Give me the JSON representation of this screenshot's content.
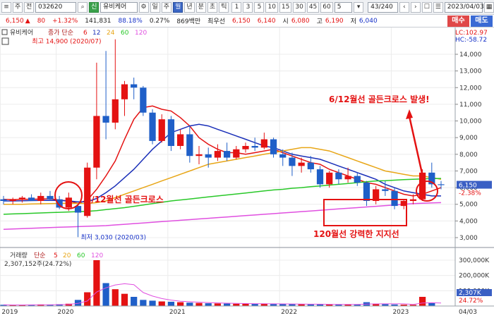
{
  "toolbar": {
    "market_label": "주",
    "sub_label": "전",
    "code": "032620",
    "search_icon": "magnifier-icon",
    "badge": "신",
    "name": "유비케어",
    "periods": [
      "일",
      "주",
      "월",
      "년",
      "분",
      "초",
      "틱"
    ],
    "active_period": "월",
    "minutes": [
      "1",
      "3",
      "5",
      "10",
      "15",
      "30",
      "45",
      "60"
    ],
    "interval": "5",
    "count": "43/240",
    "date": "2023/04/03"
  },
  "quote": {
    "price": "6,150",
    "arrow": "▲",
    "change": "80",
    "change_pct": "+1.32%",
    "volume": "141,831",
    "ratio": "88.18%",
    "turnover": "0.27%",
    "amount": "869백만",
    "prefer": "최우선",
    "bid": "6,150",
    "ask": "6,140",
    "open_label": "시",
    "open": "6,080",
    "high_label": "고",
    "high": "6,190",
    "low_label": "저",
    "low": "6,040",
    "buy_label": "매수",
    "sell_label": "매도"
  },
  "price_panel": {
    "name": "유비케어",
    "ma_legend_prefix": "종가 단순",
    "ma_periods": [
      "6",
      "12",
      "24",
      "60",
      "120"
    ],
    "lc": "LC:102.97",
    "hc": "HC:-58.72",
    "last_price": "6,150",
    "last_pct": "-2.38%",
    "high_note": "최고 14,900 (2020/07)",
    "low_note": "최저 3,030 (2020/03)",
    "y_ticks": [
      "14,000",
      "13,000",
      "12,000",
      "11,000",
      "10,000",
      "9,000",
      "8,000",
      "7,000",
      "6,000",
      "5,000",
      "4,000",
      "3,000"
    ]
  },
  "annotations": {
    "golden_cross_left": "6/12월선 골든크로스",
    "golden_cross_right": "6/12월선 골든크로스 발생!",
    "support": "120월선 강력한 지지선"
  },
  "volume_panel": {
    "label": "거래량",
    "ma_prefix": "단순",
    "ma_periods": [
      "5",
      "20",
      "60",
      "120"
    ],
    "volume_text": "2,307,152주(24.72%)",
    "y_ticks": [
      "300,000K",
      "200,000K",
      "100,000K"
    ],
    "last_vol": "2,307K",
    "last_pct": "24.72%"
  },
  "x_axis": {
    "labels": [
      "2019",
      "2020",
      "2021",
      "2022",
      "2023"
    ],
    "end_label": "04/03"
  },
  "colors": {
    "up": "#e41212",
    "down": "#1f5fc8",
    "ma6": "#e41212",
    "ma12": "#1a2fb8",
    "ma24": "#e8a617",
    "ma60": "#28c828",
    "ma120": "#e050e0",
    "annotation": "#e41212"
  },
  "chart_data": {
    "type": "candlestick",
    "x_range": [
      "2019/07",
      "2023/04"
    ],
    "ylim": [
      2500,
      14900
    ],
    "candles": [
      {
        "t": "2019/07",
        "o": 5300,
        "h": 5500,
        "l": 5000,
        "c": 5200
      },
      {
        "t": "2019/08",
        "o": 5200,
        "h": 5400,
        "l": 5000,
        "c": 5300
      },
      {
        "t": "2019/09",
        "o": 5300,
        "h": 5500,
        "l": 5100,
        "c": 5400
      },
      {
        "t": "2019/10",
        "o": 5400,
        "h": 5600,
        "l": 5200,
        "c": 5200
      },
      {
        "t": "2019/11",
        "o": 5200,
        "h": 5700,
        "l": 5000,
        "c": 5500
      },
      {
        "t": "2019/12",
        "o": 5500,
        "h": 5800,
        "l": 5200,
        "c": 5300
      },
      {
        "t": "2020/01",
        "o": 5300,
        "h": 5500,
        "l": 4700,
        "c": 4800
      },
      {
        "t": "2020/02",
        "o": 4800,
        "h": 5700,
        "l": 4600,
        "c": 5400
      },
      {
        "t": "2020/03",
        "o": 4900,
        "h": 5000,
        "l": 3030,
        "c": 4500
      },
      {
        "t": "2020/04",
        "o": 4300,
        "h": 7500,
        "l": 4200,
        "c": 7200
      },
      {
        "t": "2020/05",
        "o": 7200,
        "h": 13500,
        "l": 6500,
        "c": 10300
      },
      {
        "t": "2020/06",
        "o": 10300,
        "h": 14200,
        "l": 8900,
        "c": 9900
      },
      {
        "t": "2020/07",
        "o": 9900,
        "h": 14900,
        "l": 9500,
        "c": 11300
      },
      {
        "t": "2020/08",
        "o": 11300,
        "h": 12400,
        "l": 10300,
        "c": 12200
      },
      {
        "t": "2020/09",
        "o": 12200,
        "h": 12600,
        "l": 11300,
        "c": 12000
      },
      {
        "t": "2020/10",
        "o": 12000,
        "h": 12100,
        "l": 10300,
        "c": 10500
      },
      {
        "t": "2020/11",
        "o": 10500,
        "h": 10700,
        "l": 8600,
        "c": 8800
      },
      {
        "t": "2020/12",
        "o": 8800,
        "h": 10400,
        "l": 8700,
        "c": 10100
      },
      {
        "t": "2021/01",
        "o": 10100,
        "h": 10300,
        "l": 8200,
        "c": 8500
      },
      {
        "t": "2021/02",
        "o": 8500,
        "h": 9500,
        "l": 8300,
        "c": 9200
      },
      {
        "t": "2021/03",
        "o": 9200,
        "h": 9700,
        "l": 7500,
        "c": 7900
      },
      {
        "t": "2021/04",
        "o": 7900,
        "h": 8500,
        "l": 7400,
        "c": 8000
      },
      {
        "t": "2021/05",
        "o": 8000,
        "h": 8400,
        "l": 7200,
        "c": 7800
      },
      {
        "t": "2021/06",
        "o": 7800,
        "h": 8600,
        "l": 7600,
        "c": 8200
      },
      {
        "t": "2021/07",
        "o": 8200,
        "h": 8700,
        "l": 7600,
        "c": 7800
      },
      {
        "t": "2021/08",
        "o": 7800,
        "h": 8500,
        "l": 7700,
        "c": 8300
      },
      {
        "t": "2021/09",
        "o": 8300,
        "h": 8700,
        "l": 8100,
        "c": 8500
      },
      {
        "t": "2021/10",
        "o": 8500,
        "h": 9000,
        "l": 8200,
        "c": 8400
      },
      {
        "t": "2021/11",
        "o": 8400,
        "h": 9300,
        "l": 8300,
        "c": 8900
      },
      {
        "t": "2021/12",
        "o": 8900,
        "h": 9000,
        "l": 7800,
        "c": 8000
      },
      {
        "t": "2022/01",
        "o": 8000,
        "h": 8300,
        "l": 7300,
        "c": 7800
      },
      {
        "t": "2022/02",
        "o": 7800,
        "h": 8100,
        "l": 6700,
        "c": 7300
      },
      {
        "t": "2022/03",
        "o": 7300,
        "h": 7800,
        "l": 6900,
        "c": 7500
      },
      {
        "t": "2022/04",
        "o": 7500,
        "h": 7900,
        "l": 6900,
        "c": 7100
      },
      {
        "t": "2022/05",
        "o": 7100,
        "h": 7300,
        "l": 6000,
        "c": 6200
      },
      {
        "t": "2022/06",
        "o": 6200,
        "h": 7000,
        "l": 6000,
        "c": 6900
      },
      {
        "t": "2022/07",
        "o": 6900,
        "h": 7100,
        "l": 6200,
        "c": 6500
      },
      {
        "t": "2022/08",
        "o": 6500,
        "h": 7200,
        "l": 6300,
        "c": 6700
      },
      {
        "t": "2022/09",
        "o": 6700,
        "h": 6900,
        "l": 6100,
        "c": 6300
      },
      {
        "t": "2022/10",
        "o": 6300,
        "h": 6400,
        "l": 4900,
        "c": 5200
      },
      {
        "t": "2022/11",
        "o": 5200,
        "h": 6100,
        "l": 5000,
        "c": 5900
      },
      {
        "t": "2022/12",
        "o": 5900,
        "h": 6400,
        "l": 5500,
        "c": 5800
      },
      {
        "t": "2023/01",
        "o": 5800,
        "h": 6000,
        "l": 4700,
        "c": 4900
      },
      {
        "t": "2023/02",
        "o": 4900,
        "h": 5300,
        "l": 4700,
        "c": 5200
      },
      {
        "t": "2023/03",
        "o": 5200,
        "h": 5600,
        "l": 5000,
        "c": 5300
      },
      {
        "t": "2023/04",
        "o": 5300,
        "h": 7100,
        "l": 5200,
        "c": 6900
      },
      {
        "t": "2023/05",
        "o": 6900,
        "h": 7500,
        "l": 6000,
        "c": 6200
      },
      {
        "t": "2023/06",
        "o": 6200,
        "h": 6400,
        "l": 5900,
        "c": 6150
      }
    ],
    "ma": {
      "6": [
        5300,
        5280,
        5300,
        5300,
        5320,
        5330,
        5250,
        5200,
        5050,
        5250,
        5900,
        6700,
        7600,
        8900,
        10100,
        10800,
        10900,
        10700,
        10600,
        10200,
        9700,
        9000,
        8600,
        8300,
        8100,
        8100,
        8000,
        8100,
        8200,
        8300,
        8100,
        7900,
        7700,
        7500,
        7400,
        7100,
        6900,
        6700,
        6500,
        6300,
        6200,
        6000,
        5800,
        5600,
        5500,
        5600,
        5800,
        6000
      ],
      "12": [
        5200,
        5200,
        5210,
        5220,
        5230,
        5240,
        5230,
        5200,
        5150,
        5150,
        5350,
        5700,
        6100,
        6600,
        7100,
        7700,
        8300,
        8800,
        9300,
        9500,
        9700,
        9800,
        9700,
        9500,
        9300,
        9100,
        8900,
        8700,
        8500,
        8400,
        8200,
        8000,
        7900,
        7800,
        7700,
        7500,
        7300,
        7100,
        6900,
        6700,
        6500,
        6200,
        6000,
        5800,
        5700,
        5600,
        5500,
        5500
      ],
      "24": [
        5000,
        5000,
        5000,
        5020,
        5030,
        5040,
        5050,
        5060,
        5050,
        5050,
        5100,
        5200,
        5400,
        5600,
        5800,
        6000,
        6200,
        6400,
        6600,
        6800,
        7000,
        7200,
        7400,
        7500,
        7600,
        7700,
        7800,
        7900,
        8000,
        8100,
        8200,
        8300,
        8400,
        8400,
        8300,
        8200,
        8000,
        7800,
        7600,
        7400,
        7200,
        7000,
        6900,
        6800,
        6700,
        6700,
        6600,
        6500
      ],
      "60": [
        4400,
        4420,
        4440,
        4460,
        4480,
        4500,
        4520,
        4540,
        4560,
        4580,
        4620,
        4680,
        4740,
        4800,
        4880,
        4960,
        5040,
        5120,
        5200,
        5260,
        5320,
        5380,
        5440,
        5500,
        5560,
        5620,
        5680,
        5740,
        5800,
        5860,
        5900,
        5960,
        6000,
        6060,
        6100,
        6150,
        6200,
        6250,
        6300,
        6350,
        6400,
        6420,
        6450,
        6480,
        6500,
        6520,
        6540,
        6550
      ],
      "120": [
        3500,
        3520,
        3540,
        3560,
        3580,
        3600,
        3620,
        3640,
        3660,
        3680,
        3700,
        3720,
        3760,
        3800,
        3840,
        3880,
        3920,
        3960,
        4000,
        4040,
        4080,
        4120,
        4160,
        4200,
        4240,
        4280,
        4320,
        4360,
        4400,
        4440,
        4480,
        4520,
        4560,
        4600,
        4640,
        4680,
        4720,
        4760,
        4800,
        4840,
        4880,
        4920,
        4960,
        5000,
        5040,
        5060,
        5080,
        5100
      ]
    },
    "volume_k": [
      8,
      6,
      7,
      9,
      10,
      8,
      12,
      15,
      40,
      90,
      300,
      150,
      110,
      80,
      60,
      40,
      35,
      30,
      28,
      25,
      22,
      20,
      18,
      17,
      16,
      15,
      15,
      14,
      14,
      13,
      13,
      12,
      12,
      11,
      11,
      10,
      10,
      10,
      9,
      25,
      15,
      12,
      10,
      9,
      8,
      60,
      20,
      2.3
    ]
  }
}
